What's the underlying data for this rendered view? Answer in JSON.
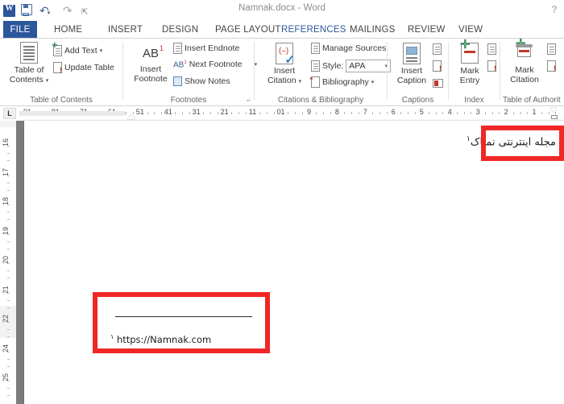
{
  "window": {
    "title": "Namnak.docx - Word",
    "help_icon": "?",
    "quick_access": [
      {
        "name": "word-logo",
        "label": "W"
      },
      {
        "name": "save-icon",
        "label": "Save"
      },
      {
        "name": "undo-icon",
        "label": "Undo"
      },
      {
        "name": "redo-icon",
        "label": "Redo"
      },
      {
        "name": "customize-qat-icon",
        "label": "Customize Quick Access Toolbar"
      }
    ]
  },
  "tabs": [
    {
      "label": "FILE",
      "active": false,
      "file": true
    },
    {
      "label": "HOME",
      "active": false
    },
    {
      "label": "INSERT",
      "active": false
    },
    {
      "label": "DESIGN",
      "active": false
    },
    {
      "label": "PAGE LAYOUT",
      "active": false
    },
    {
      "label": "REFERENCES",
      "active": true
    },
    {
      "label": "MAILINGS",
      "active": false
    },
    {
      "label": "REVIEW",
      "active": false
    },
    {
      "label": "VIEW",
      "active": false
    }
  ],
  "ribbon": {
    "groups": [
      {
        "name": "table-of-contents",
        "label": "Table of Contents",
        "big_button": {
          "line1": "Table of",
          "line2": "Contents",
          "caret": "▾"
        },
        "small_buttons": [
          {
            "label": "Add Text",
            "caret": "▾"
          },
          {
            "label": "Update Table",
            "caret": ""
          }
        ]
      },
      {
        "name": "footnotes",
        "label": "Footnotes",
        "big_button": {
          "glyph": "AB",
          "sup": "1",
          "line1": "Insert",
          "line2": "Footnote"
        },
        "small_buttons": [
          {
            "label": "Insert Endnote",
            "caret": ""
          },
          {
            "label": "Next Footnote",
            "caret": "▾"
          },
          {
            "label": "Show Notes",
            "caret": ""
          }
        ],
        "dialog_launcher": "⌐"
      },
      {
        "name": "citations-bibliography",
        "label": "Citations & Bibliography",
        "big_button": {
          "line1": "Insert",
          "line2": "Citation",
          "caret": "▾"
        },
        "small_buttons": [
          {
            "label": "Manage Sources",
            "caret": ""
          },
          {
            "label": "Style:",
            "caret": ""
          },
          {
            "label": "Bibliography",
            "caret": "▾"
          }
        ],
        "style_dropdown": {
          "value": "APA",
          "caret": "▾"
        }
      },
      {
        "name": "captions",
        "label": "Captions",
        "big_button": {
          "line1": "Insert",
          "line2": "Caption"
        }
      },
      {
        "name": "index",
        "label": "Index",
        "big_button": {
          "line1": "Mark",
          "line2": "Entry"
        }
      },
      {
        "name": "table-of-authorities",
        "label": "Table of Authorit",
        "big_button": {
          "line1": "Mark",
          "line2": "Citation"
        }
      }
    ]
  },
  "ruler": {
    "tab_stop_marker": "L",
    "horizontal_labels": [
      "91",
      "81",
      "71",
      "61",
      "51",
      "41",
      "31",
      "21",
      "11",
      "01",
      "9",
      "8",
      "7",
      "6",
      "5",
      "4",
      "3",
      "2",
      "1"
    ],
    "vertical_labels": [
      "16",
      "17",
      "18",
      "19",
      "20",
      "21",
      "22",
      "24",
      "25"
    ]
  },
  "document": {
    "body_text": "مجله اینترنتی نمناک",
    "body_footnote_mark": "١",
    "footnote_text": "https://Namnak.com",
    "footnote_mark": "١"
  },
  "annotations": {
    "highlight_color": "#ef2727",
    "boxes": [
      {
        "name": "body-footnote-reference-highlight"
      },
      {
        "name": "footnote-area-highlight"
      }
    ]
  }
}
